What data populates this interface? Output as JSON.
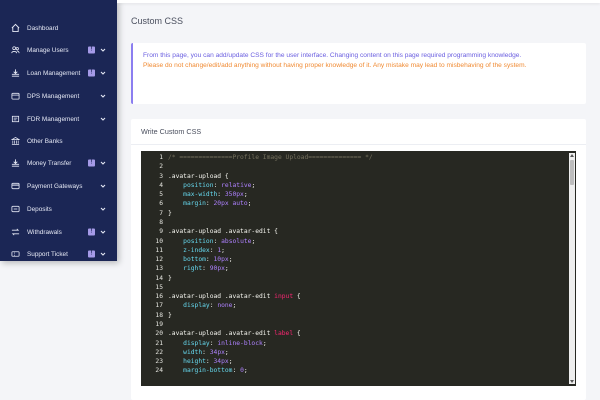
{
  "sidebar": {
    "items": [
      {
        "label": "Dashboard",
        "icon": "home-icon",
        "badge": "",
        "chevron": false
      },
      {
        "label": "Manage Users",
        "icon": "users-icon",
        "badge": "!",
        "chevron": true
      },
      {
        "label": "Loan Management",
        "icon": "loan-icon",
        "badge": "!",
        "chevron": true
      },
      {
        "label": "DPS Management",
        "icon": "wallet-icon",
        "badge": "",
        "chevron": true
      },
      {
        "label": "FDR Management",
        "icon": "document-icon",
        "badge": "",
        "chevron": true
      },
      {
        "label": "Other Banks",
        "icon": "bank-icon",
        "badge": "",
        "chevron": false
      },
      {
        "label": "Money Transfer",
        "icon": "transfer-icon",
        "badge": "!",
        "chevron": true
      },
      {
        "label": "Payment Gateways",
        "icon": "card-icon",
        "badge": "",
        "chevron": true
      },
      {
        "label": "Deposits",
        "icon": "deposit-icon",
        "badge": "",
        "chevron": true
      },
      {
        "label": "Withdrawals",
        "icon": "withdraw-icon",
        "badge": "!",
        "chevron": true
      },
      {
        "label": "Support Ticket",
        "icon": "ticket-icon",
        "badge": "!",
        "chevron": true
      }
    ]
  },
  "page": {
    "title": "Custom CSS"
  },
  "alert": {
    "info": "From this page, you can add/update CSS for the user interface. Changing content on this page required programming knowledge.",
    "warning": "Please do not change/edit/add anything without having proper knowledge of it. Any mistake may lead to misbehaving of the system."
  },
  "card": {
    "title": "Write Custom CSS"
  },
  "editor": {
    "lines": [
      {
        "n": "1",
        "text": "/* ==============Profile Image Upload============== */"
      },
      {
        "n": "2",
        "text": ""
      },
      {
        "n": "3",
        "text": ".avatar-upload {"
      },
      {
        "n": "4",
        "text": "    position: relative;"
      },
      {
        "n": "5",
        "text": "    max-width: 350px;"
      },
      {
        "n": "6",
        "text": "    margin: 20px auto;"
      },
      {
        "n": "7",
        "text": "}"
      },
      {
        "n": "8",
        "text": ""
      },
      {
        "n": "9",
        "text": ".avatar-upload .avatar-edit {"
      },
      {
        "n": "10",
        "text": "    position: absolute;"
      },
      {
        "n": "11",
        "text": "    z-index: 1;"
      },
      {
        "n": "12",
        "text": "    bottom: 10px;"
      },
      {
        "n": "13",
        "text": "    right: 90px;"
      },
      {
        "n": "14",
        "text": "}"
      },
      {
        "n": "15",
        "text": ""
      },
      {
        "n": "16",
        "text": ".avatar-upload .avatar-edit input {"
      },
      {
        "n": "17",
        "text": "    display: none;"
      },
      {
        "n": "18",
        "text": "}"
      },
      {
        "n": "19",
        "text": ""
      },
      {
        "n": "20",
        "text": ".avatar-upload .avatar-edit label {"
      },
      {
        "n": "21",
        "text": "    display: inline-block;"
      },
      {
        "n": "22",
        "text": "    width: 34px;"
      },
      {
        "n": "23",
        "text": "    height: 34px;"
      },
      {
        "n": "24",
        "text": "    margin-bottom: 0;"
      }
    ]
  },
  "colors": {
    "sidebar_bg": "#1b2655",
    "accent": "#8b7ef0",
    "info_text": "#6a5ee0",
    "warning_text": "#f08a32",
    "editor_bg": "#272822"
  }
}
